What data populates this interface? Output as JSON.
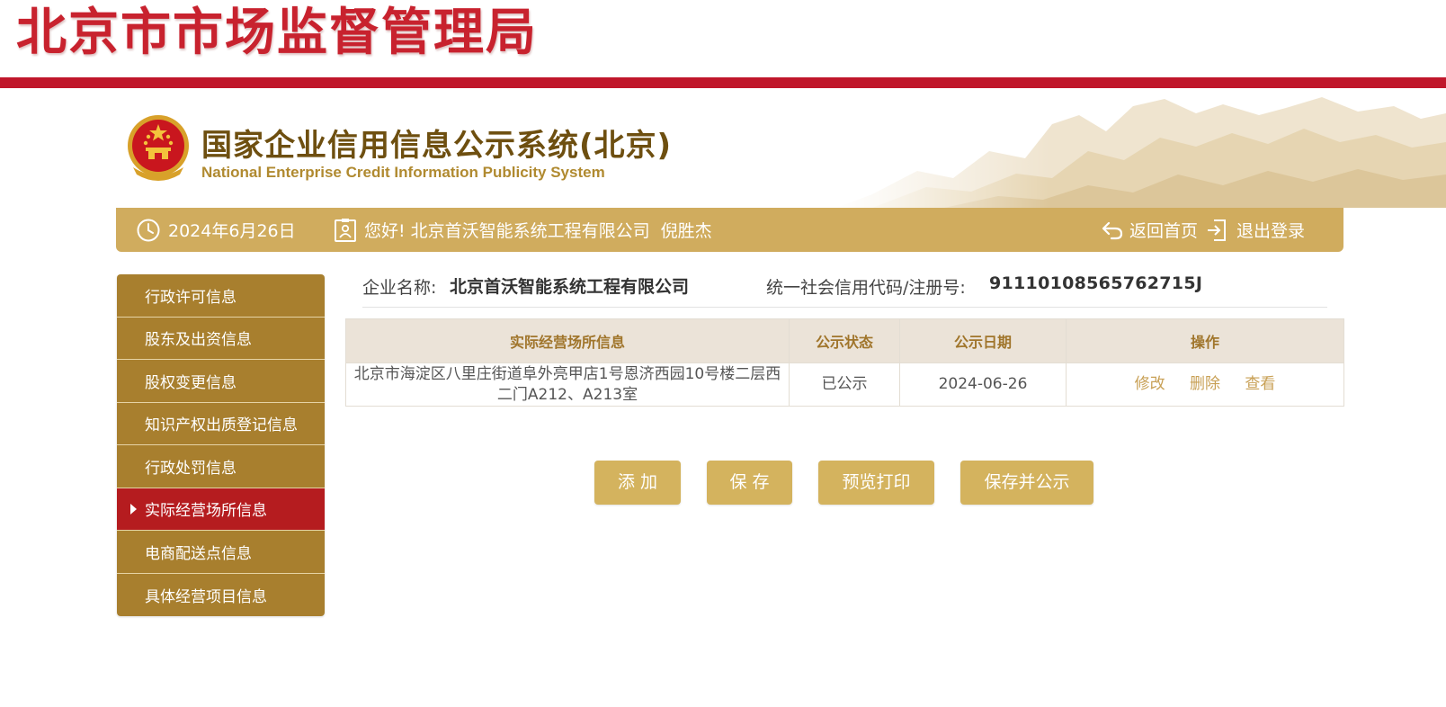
{
  "colors": {
    "bureau_red": "#c8222e",
    "bar_red": "#c0172b",
    "gold": "#d0ac5e",
    "sidebar_gold": "#a87f2e",
    "sidebar_active": "#b51c1f",
    "table_header_bg": "#ebe3d8",
    "link": "#c8a055"
  },
  "bureau": {
    "title": "北京市市场监督管理局"
  },
  "system": {
    "title_cn": "国家企业信用信息公示系统(北京)",
    "title_en": "National Enterprise Credit Information Publicity System",
    "emblem_icon": "national-emblem-icon"
  },
  "info_bar": {
    "date": "2024年6月26日",
    "greeting": "您好!",
    "company": "北京首沃智能系统工程有限公司",
    "person": "倪胜杰",
    "home_label": "返回首页",
    "logout_label": "退出登录"
  },
  "sidebar": {
    "items": [
      {
        "label": "行政许可信息",
        "active": false
      },
      {
        "label": "股东及出资信息",
        "active": false
      },
      {
        "label": "股权变更信息",
        "active": false
      },
      {
        "label": "知识产权出质登记信息",
        "active": false
      },
      {
        "label": "行政处罚信息",
        "active": false
      },
      {
        "label": "实际经营场所信息",
        "active": true
      },
      {
        "label": "电商配送点信息",
        "active": false
      },
      {
        "label": "具体经营项目信息",
        "active": false
      }
    ]
  },
  "company_info": {
    "name_label": "企业名称:",
    "name_value": "北京首沃智能系统工程有限公司",
    "code_label": "统一社会信用代码/注册号:",
    "code_value": "91110108565762715J"
  },
  "table": {
    "headers": [
      "实际经营场所信息",
      "公示状态",
      "公示日期",
      "操作"
    ],
    "rows": [
      {
        "address": "北京市海淀区八里庄街道阜外亮甲店1号恩济西园10号楼二层西二门A212、A213室",
        "status": "已公示",
        "date": "2024-06-26",
        "actions": [
          "修改",
          "删除",
          "查看"
        ]
      }
    ]
  },
  "buttons": {
    "add": "添加",
    "save": "保存",
    "preview_print": "预览打印",
    "save_publish": "保存并公示"
  }
}
